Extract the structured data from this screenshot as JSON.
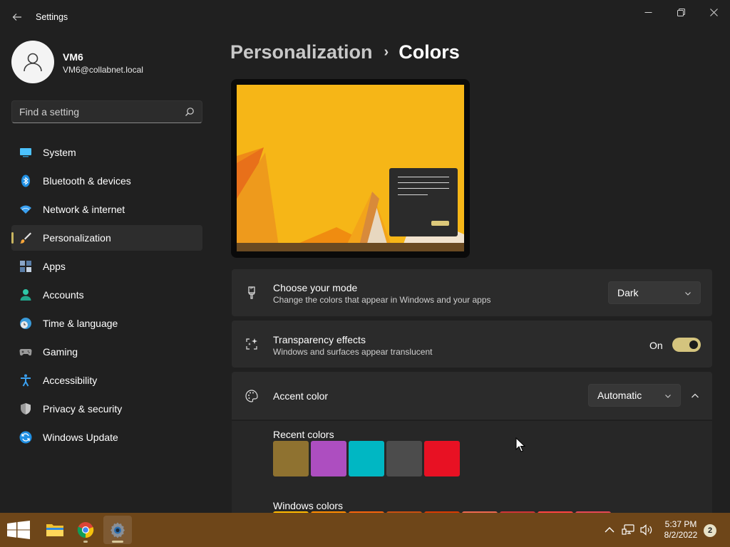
{
  "window": {
    "title": "Settings",
    "controls": {
      "minimize_icon": "minimize-icon",
      "maximize_icon": "restore-icon",
      "close_icon": "close-icon"
    }
  },
  "profile": {
    "name": "VM6",
    "email": "VM6@collabnet.local"
  },
  "search": {
    "placeholder": "Find a setting"
  },
  "sidebar": {
    "items": [
      {
        "label": "System",
        "icon": "system-icon",
        "selected": false
      },
      {
        "label": "Bluetooth & devices",
        "icon": "bluetooth-icon",
        "selected": false
      },
      {
        "label": "Network & internet",
        "icon": "wifi-icon",
        "selected": false
      },
      {
        "label": "Personalization",
        "icon": "brush-icon",
        "selected": true
      },
      {
        "label": "Apps",
        "icon": "apps-icon",
        "selected": false
      },
      {
        "label": "Accounts",
        "icon": "accounts-icon",
        "selected": false
      },
      {
        "label": "Time & language",
        "icon": "clock-globe-icon",
        "selected": false
      },
      {
        "label": "Gaming",
        "icon": "gamepad-icon",
        "selected": false
      },
      {
        "label": "Accessibility",
        "icon": "accessibility-icon",
        "selected": false
      },
      {
        "label": "Privacy & security",
        "icon": "shield-icon",
        "selected": false
      },
      {
        "label": "Windows Update",
        "icon": "update-icon",
        "selected": false
      }
    ]
  },
  "breadcrumb": {
    "parent": "Personalization",
    "separator": "›",
    "current": "Colors"
  },
  "mode_card": {
    "title": "Choose your mode",
    "description": "Change the colors that appear in Windows and your apps",
    "value": "Dark"
  },
  "transparency_card": {
    "title": "Transparency effects",
    "description": "Windows and surfaces appear translucent",
    "state_label": "On",
    "on": true
  },
  "accent_card": {
    "title": "Accent color",
    "value": "Automatic",
    "expanded": true,
    "recent_label": "Recent colors",
    "recent_colors": [
      "#8f7230",
      "#ad4ec0",
      "#00b7c3",
      "#4c4c4c",
      "#e81123"
    ],
    "windows_label": "Windows colors",
    "windows_colors": [
      "#ffb900",
      "#ff8c00",
      "#f7630c",
      "#ca5010",
      "#da3b01",
      "#ef6950",
      "#d13438",
      "#ff4343",
      "#e74856"
    ]
  },
  "taskbar": {
    "apps": [
      "windows-start-icon",
      "file-explorer-icon",
      "chrome-icon",
      "settings-icon"
    ],
    "active_app": "settings-icon",
    "time": "5:37 PM",
    "date": "8/2/2022",
    "notification_count": "2"
  },
  "colors": {
    "background": "#202020",
    "card": "#2b2b2b",
    "accent": "#d4c47e",
    "taskbar": "#6e4619"
  }
}
